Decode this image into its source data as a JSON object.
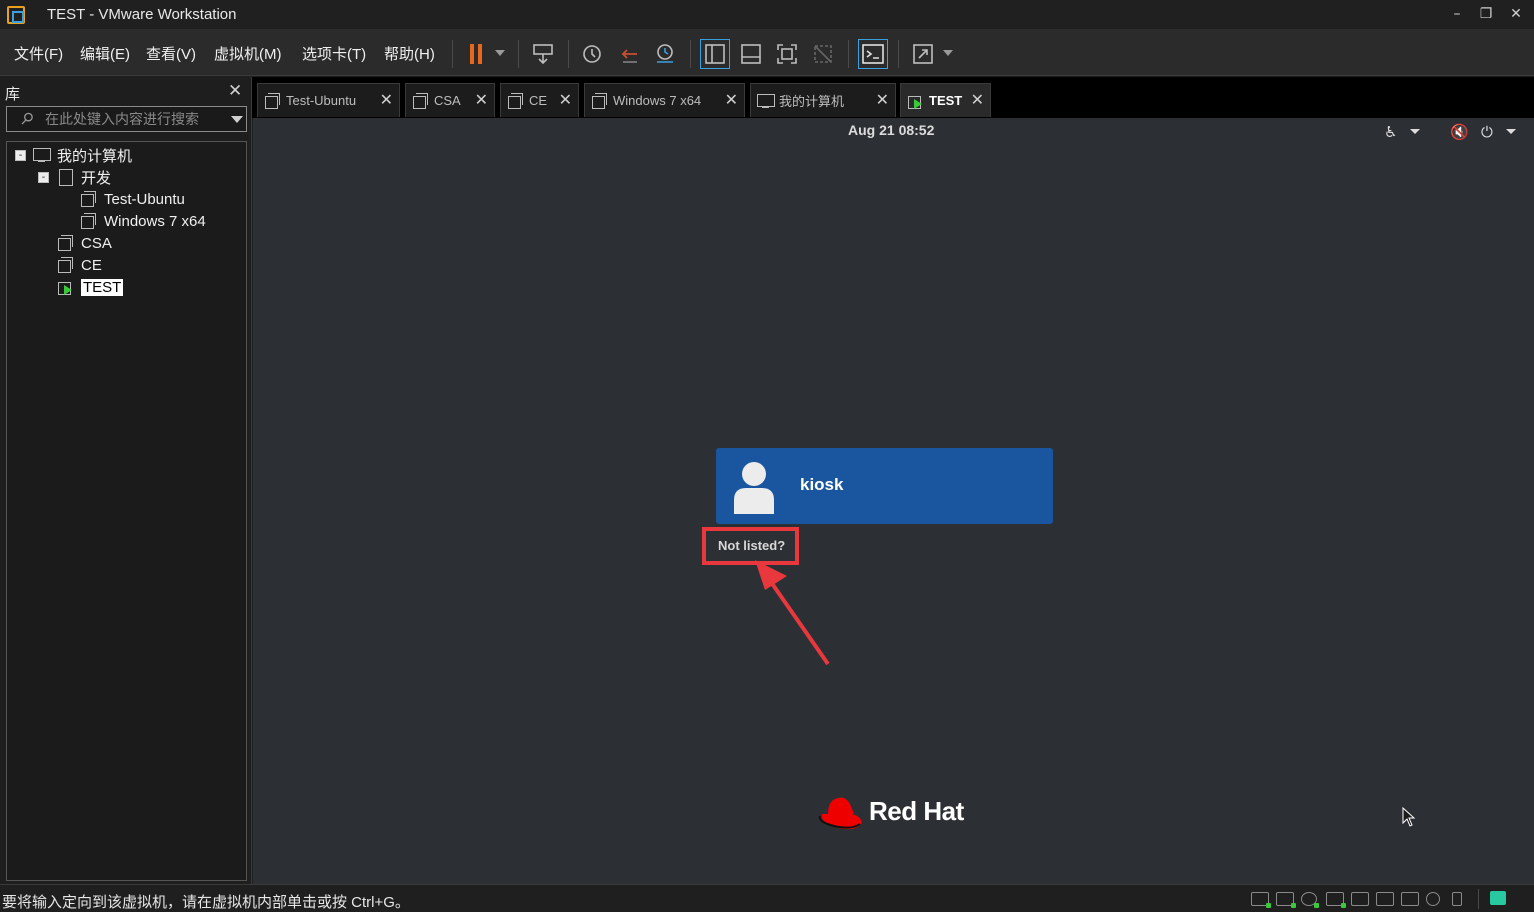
{
  "window": {
    "title": "TEST - VMware Workstation"
  },
  "menu": [
    "文件(F)",
    "编辑(E)",
    "查看(V)",
    "虚拟机(M)",
    "选项卡(T)",
    "帮助(H)"
  ],
  "library": {
    "header": "库",
    "search_placeholder": "在此处键入内容进行搜索",
    "tree": [
      {
        "label": "我的计算机",
        "icon": "computer-icon"
      },
      {
        "label": "开发",
        "icon": "folder-icon"
      },
      {
        "label": "Test-Ubuntu",
        "icon": "vm-icon"
      },
      {
        "label": "Windows 7 x64",
        "icon": "vm-icon"
      },
      {
        "label": "CSA",
        "icon": "vm-icon"
      },
      {
        "label": "CE",
        "icon": "vm-icon"
      },
      {
        "label": "TEST",
        "icon": "vm-running-icon",
        "selected": true
      }
    ]
  },
  "tabs": [
    {
      "label": "Test-Ubuntu"
    },
    {
      "label": "CSA"
    },
    {
      "label": "CE"
    },
    {
      "label": "Windows 7 x64"
    },
    {
      "label": "我的计算机"
    },
    {
      "label": "TEST",
      "active": true
    }
  ],
  "guest": {
    "datetime": "Aug 21  08:52",
    "username": "kiosk",
    "not_listed": "Not listed?",
    "brand": "Red Hat"
  },
  "status": {
    "message": "要将输入定向到该虚拟机，请在虚拟机内部单击或按 Ctrl+G。"
  },
  "colors": {
    "user_card": "#1a56a0",
    "highlight_box": "#e8383d",
    "guest_bg": "#2c3034",
    "pause": "#e8671f"
  }
}
